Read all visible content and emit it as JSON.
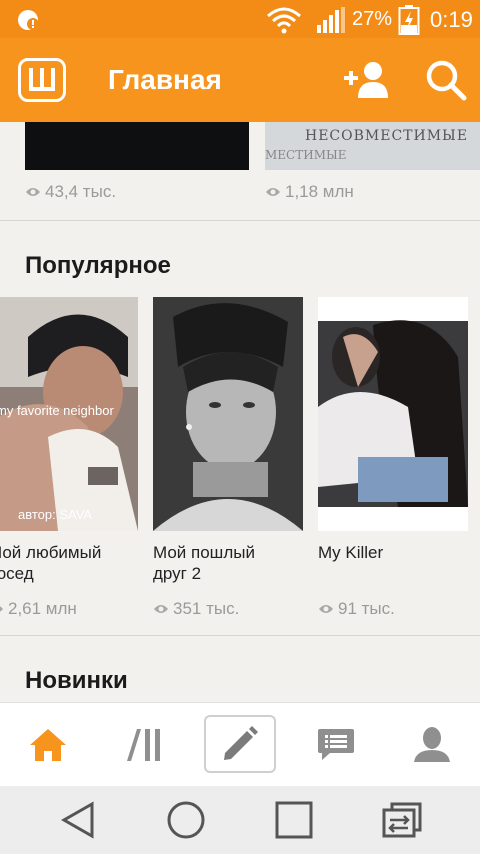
{
  "status_bar": {
    "battery_percent": "27%",
    "time": "0:19"
  },
  "app_bar": {
    "logo_letter": "Ш",
    "title": "Главная",
    "icons": [
      "add-user-icon",
      "search-icon"
    ]
  },
  "top_row": {
    "left": {
      "views": "43,4 тыс."
    },
    "right": {
      "cover_title": "НЕСОВМЕСТИМЫЕ",
      "cover_subtitle": "МЕСТИМЫЕ",
      "views": "1,18 млн"
    }
  },
  "sections": {
    "popular": {
      "title": "Популярное",
      "items": [
        {
          "title": "Мой любимый\nсосед",
          "views": "2,61 млн",
          "cover_text": "my favorite neighbor",
          "cover_author": "автор: SAVA"
        },
        {
          "title": "Мой пошлый\nдруг 2",
          "views": "351 тыс."
        },
        {
          "title": "My Killer",
          "views": "91 тыс."
        }
      ]
    },
    "new": {
      "title": "Новинки"
    }
  },
  "tab_bar": {
    "tabs": [
      "home-icon",
      "library-icon",
      "write-icon",
      "messages-icon",
      "profile-icon"
    ],
    "active": "home-icon",
    "accent": "#f7941d"
  },
  "system_nav": [
    "back-icon",
    "home-circle-icon",
    "recents-icon",
    "switch-apps-icon"
  ],
  "colors": {
    "brand": "#f7941d",
    "status": "#f28c16"
  }
}
